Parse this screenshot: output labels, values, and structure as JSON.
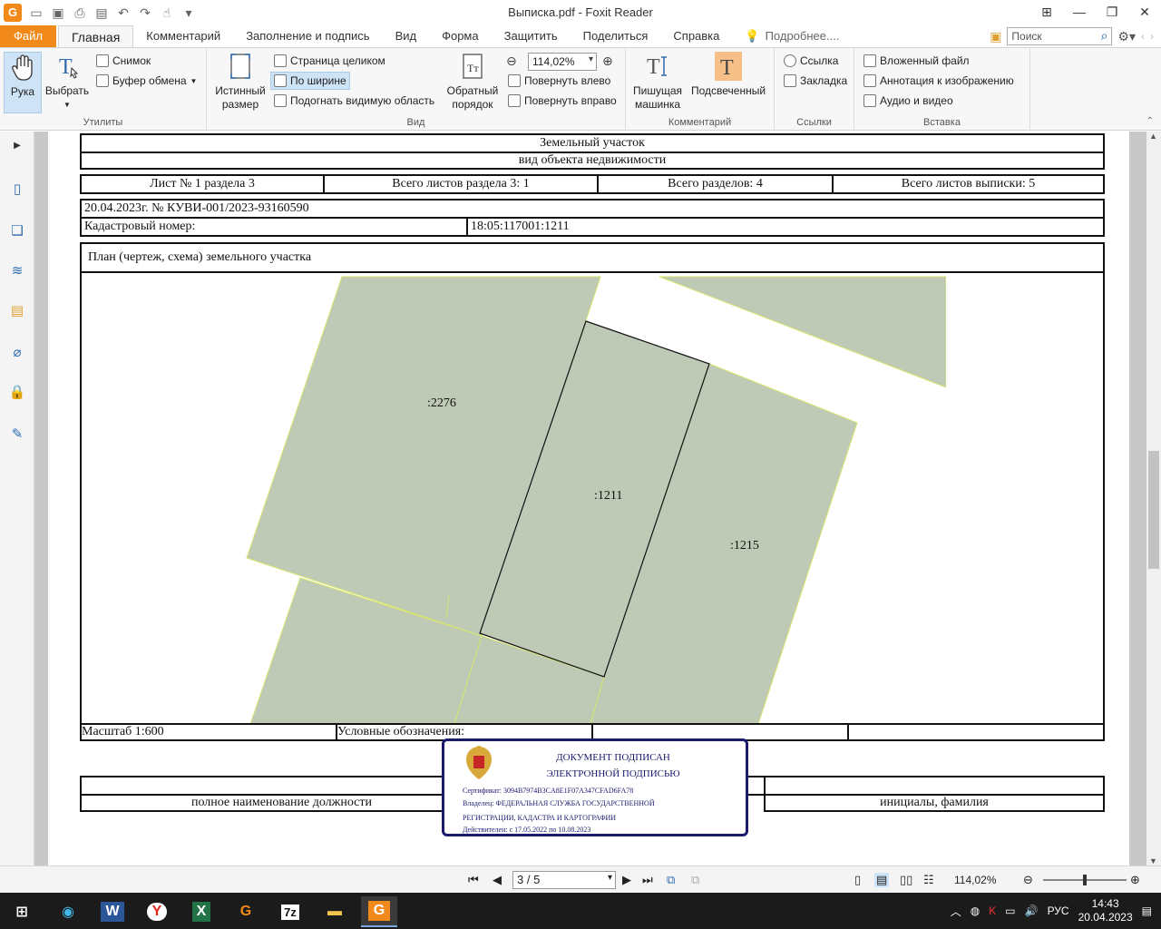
{
  "window": {
    "title": "Выписка.pdf - Foxit Reader",
    "app_logo": "G"
  },
  "tabs": {
    "file": "Файл",
    "items": [
      "Главная",
      "Комментарий",
      "Заполнение и подпись",
      "Вид",
      "Форма",
      "Защитить",
      "Поделиться",
      "Справка"
    ],
    "tell_more": "Подробнее....",
    "search_placeholder": "Поиск"
  },
  "ribbon": {
    "utilities": {
      "label": "Утилиты",
      "hand": "Рука",
      "select": "Выбрать",
      "snapshot": "Снимок",
      "clipboard": "Буфер обмена"
    },
    "view": {
      "label": "Вид",
      "actual_size_1": "Истинный",
      "actual_size_2": "размер",
      "fit_page": "Страница целиком",
      "fit_width": "По ширине",
      "fit_visible": "Подогнать видимую область",
      "reverse_1": "Обратный",
      "reverse_2": "порядок",
      "zoom": "114,02%",
      "rotate_left": "Повернуть влево",
      "rotate_right": "Повернуть вправо"
    },
    "comment": {
      "label": "Комментарий",
      "typewriter_1": "Пишущая",
      "typewriter_2": "машинка",
      "highlight": "Подсвеченный"
    },
    "links": {
      "label": "Ссылки",
      "link": "Ссылка",
      "bookmark": "Закладка"
    },
    "insert": {
      "label": "Вставка",
      "attachment": "Вложенный файл",
      "image_annot": "Аннотация к изображению",
      "audio_video": "Аудио и видео"
    }
  },
  "document": {
    "header_1": "Земельный участок",
    "header_2": "вид объекта недвижимости",
    "sheet_no": "Лист № 1 раздела 3",
    "sheets_in_section": "Всего листов раздела 3: 1",
    "sections_total": "Всего разделов: 4",
    "sheets_total": "Всего листов выписки: 5",
    "date_number": "20.04.2023г. № КУВИ-001/2023-93160590",
    "cadastral_label": "Кадастровый номер:",
    "cadastral_value": "18:05:117001:1211",
    "plan_title": "План (чертеж, схема) земельного участка",
    "parcel_a": ":2276",
    "parcel_b": ":1211",
    "parcel_c": ":1215",
    "scale": "Масштаб 1:600",
    "legend": "Условные обозначения:",
    "position_label": "полное наименование должности",
    "initials_label": "инициалы, фамилия",
    "stamp": {
      "line1": "ДОКУМЕНТ ПОДПИСАН",
      "line2": "ЭЛЕКТРОННОЙ ПОДПИСЬЮ",
      "cert": "Сертификат: 3094B7974B3CA8E1F07A347CFAD6FA78",
      "owner1": "Владелец: ФЕДЕРАЛЬНАЯ СЛУЖБА ГОСУДАРСТВЕННОЙ",
      "owner2": "РЕГИСТРАЦИИ, КАДАСТРА И КАРТОГРАФИИ",
      "valid": "Действителен: с 17.05.2022 по 10.08.2023"
    }
  },
  "statusbar": {
    "page": "3 / 5",
    "zoom": "114,02%"
  },
  "taskbar": {
    "lang": "РУС",
    "time": "14:43",
    "date": "20.04.2023"
  },
  "colors": {
    "accent": "#f28a1b",
    "parcel_fill": "#bec9b6",
    "parcel_edge": "#d8e66e"
  }
}
